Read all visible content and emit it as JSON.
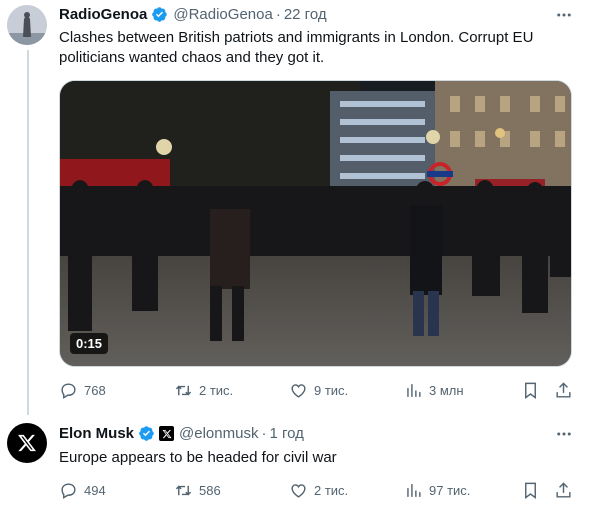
{
  "colors": {
    "accent": "#1d9bf0",
    "text": "#0f1419",
    "secondary": "#536471"
  },
  "tweets": [
    {
      "author_name": "RadioGenoa",
      "handle": "@RadioGenoa",
      "separator": "·",
      "time": "22 год",
      "text_line1": "Clashes between British patriots and immigrants in London. Corrupt EU",
      "text_line2": "politicians wanted chaos and they got it.",
      "video_duration": "0:15",
      "replies": "768",
      "reposts": "2 тис.",
      "likes": "9 тис.",
      "views": "3 млн",
      "icons": [
        "more-icon",
        "verified-badge-icon",
        "reply-icon",
        "repost-icon",
        "like-icon",
        "views-icon",
        "bookmark-icon",
        "share-icon"
      ]
    },
    {
      "author_name": "Elon Musk",
      "handle": "@elonmusk",
      "separator": "·",
      "time": "1 год",
      "text": "Europe appears to be headed for civil war",
      "replies": "494",
      "reposts": "586",
      "likes": "2 тис.",
      "views": "97 тис.",
      "icons": [
        "x-logo-icon",
        "verified-badge-icon",
        "x-affiliate-badge-icon",
        "more-icon"
      ]
    }
  ]
}
